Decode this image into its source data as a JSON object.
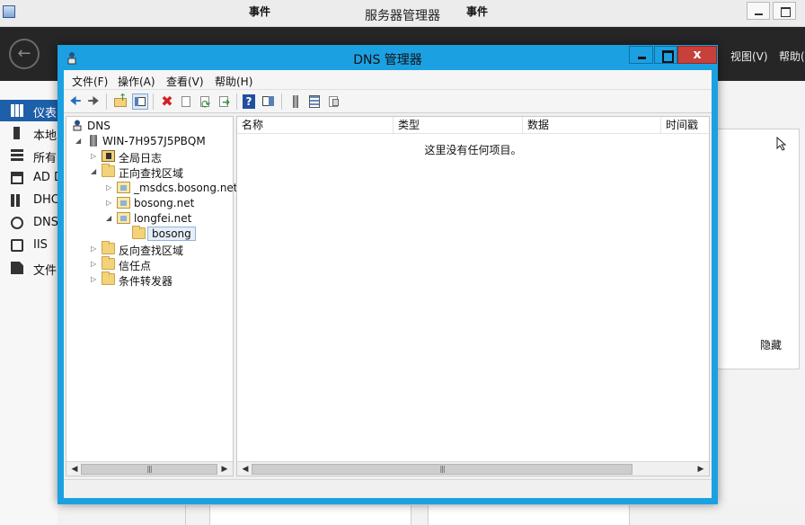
{
  "server_manager": {
    "title": "服务器管理器",
    "menu": {
      "view": "视图(V)",
      "help": "帮助(H)"
    },
    "sidebar": [
      {
        "label": "仪表",
        "icon": "dashboard-icon",
        "active": true
      },
      {
        "label": "本地",
        "icon": "local-server-icon"
      },
      {
        "label": "所有",
        "icon": "all-servers-icon"
      },
      {
        "label": "AD D",
        "icon": "ad-ds-icon"
      },
      {
        "label": "DHC",
        "icon": "dhcp-icon"
      },
      {
        "label": "DNS",
        "icon": "dns-role-icon"
      },
      {
        "label": "IIS",
        "icon": "iis-icon"
      },
      {
        "label": "文件",
        "icon": "file-services-icon"
      }
    ],
    "right_panel": {
      "hide_label": "隐藏"
    },
    "events": [
      "事件",
      "事件"
    ]
  },
  "dns_manager": {
    "title": "DNS 管理器",
    "close_glyph": "x",
    "menu": {
      "file": "文件(F)",
      "action": "操作(A)",
      "view": "查看(V)",
      "help": "帮助(H)"
    },
    "tree": {
      "root": "DNS",
      "server": "WIN-7H957J5PBQM",
      "global_logs": "全局日志",
      "forward_zones": "正向查找区域",
      "zones": [
        "_msdcs.bosong.net",
        "bosong.net",
        "longfei.net"
      ],
      "selected": "bosong",
      "reverse_zones": "反向查找区域",
      "trust_points": "信任点",
      "conditional_forwarders": "条件转发器"
    },
    "list": {
      "columns": [
        "名称",
        "类型",
        "数据",
        "时间戳"
      ],
      "empty_message": "这里没有任何项目。"
    }
  }
}
